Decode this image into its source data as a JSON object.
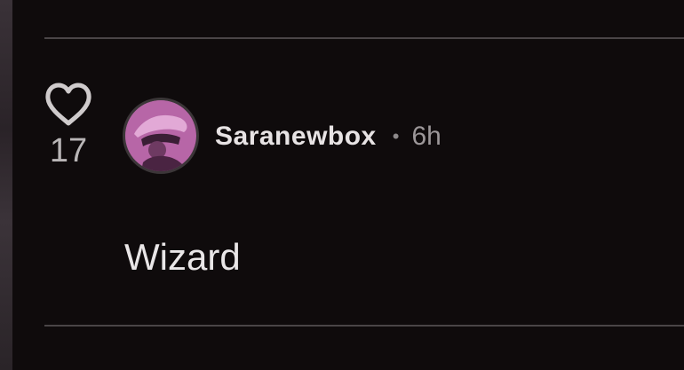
{
  "comment": {
    "like_count": "17",
    "author": {
      "username": "Saranewbox",
      "separator": "•",
      "time_ago": "6h"
    },
    "text": "Wizard"
  },
  "icons": {
    "like": "heart-outline-icon"
  },
  "colors": {
    "background": "#0f0b0c",
    "divider": "#4a4547",
    "primary_text": "#e7e3e4",
    "secondary_text": "#9c9799",
    "icon": "#cfcbcc"
  }
}
